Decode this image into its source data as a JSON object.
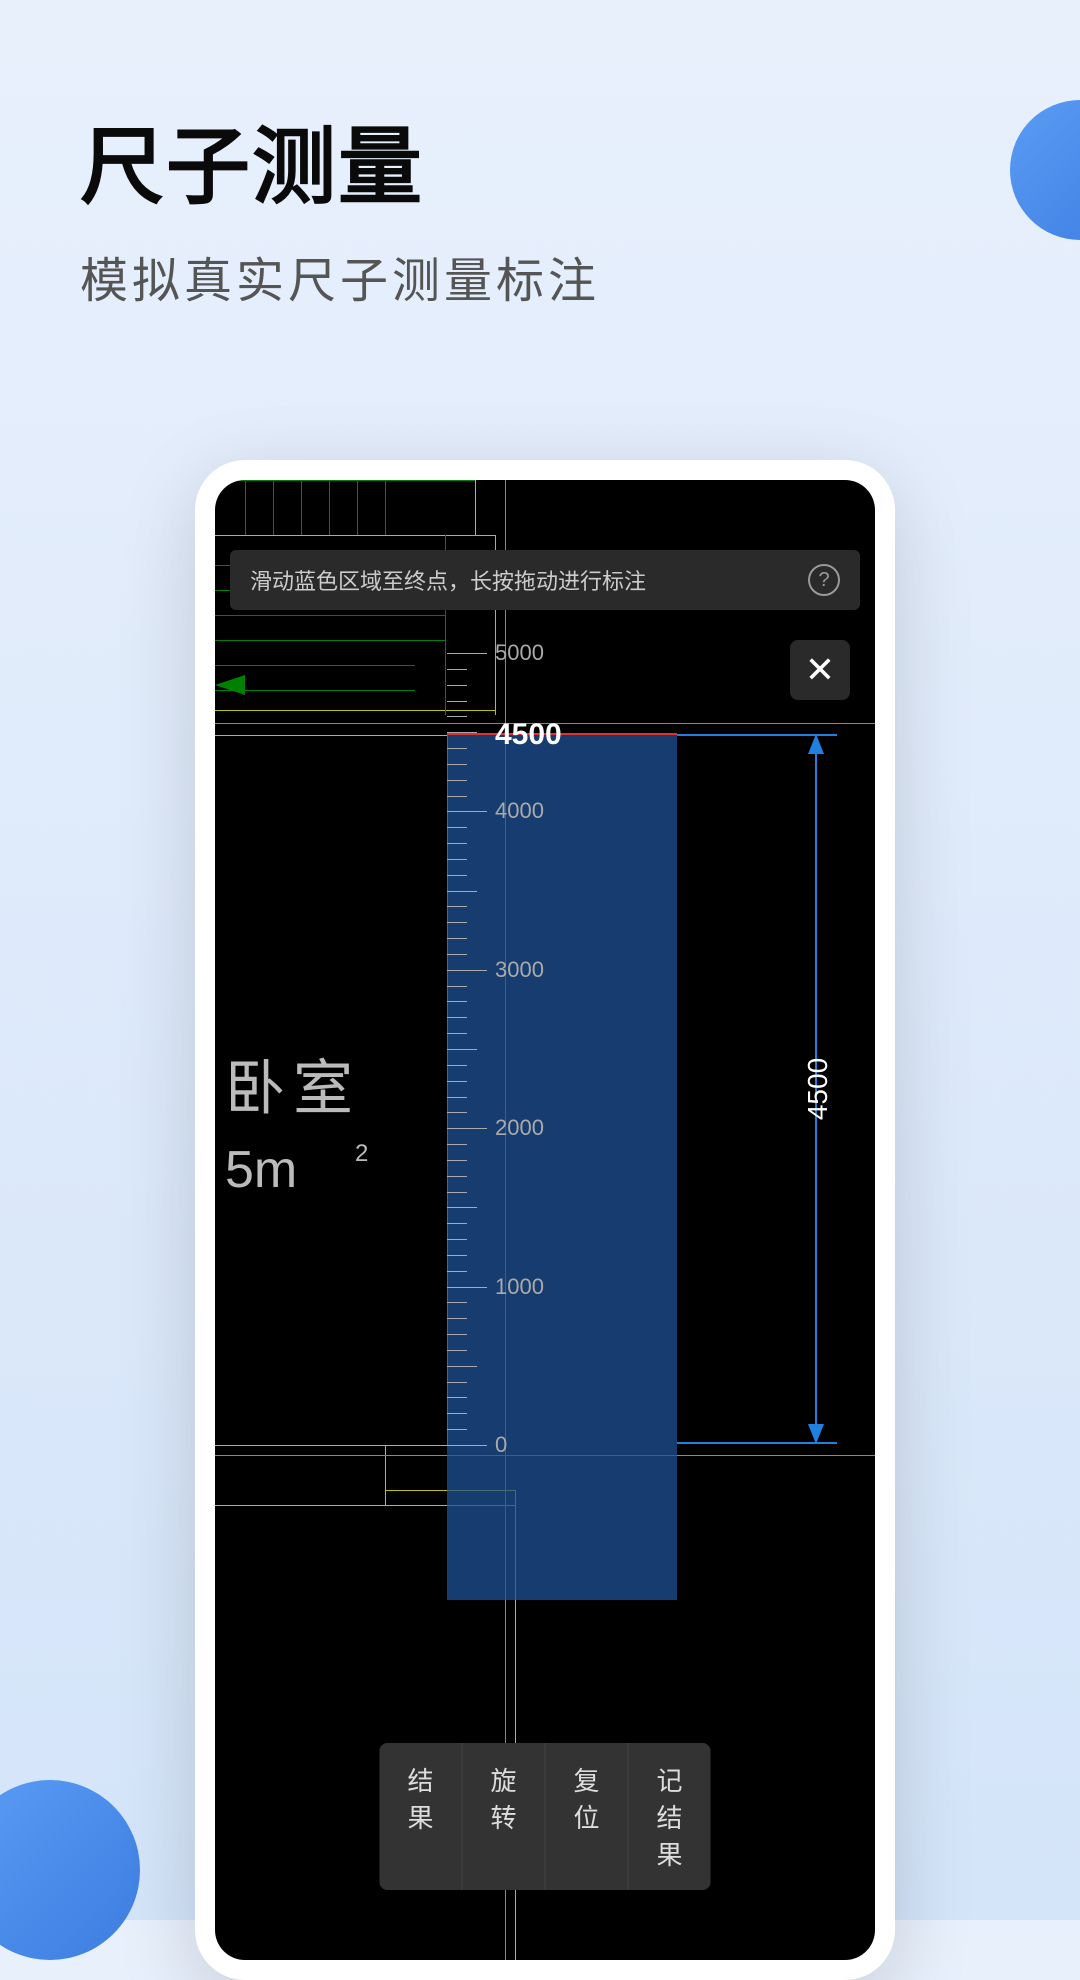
{
  "header": {
    "title": "尺子测量",
    "subtitle": "模拟真实尺子测量标注"
  },
  "hint": {
    "text": "滑动蓝色区域至终点，长按拖动进行标注",
    "help_symbol": "?"
  },
  "close": {
    "symbol": "✕"
  },
  "cad": {
    "room_label": "卧室",
    "room_size": "5m",
    "room_sup": "2"
  },
  "ruler": {
    "current_value": "4500",
    "labels": {
      "t5000": "5000",
      "t4000": "4000",
      "t3000": "3000",
      "t2000": "2000",
      "t1000": "1000",
      "t0": "0"
    }
  },
  "dimension": {
    "value": "4500"
  },
  "toolbar": {
    "result": "结果",
    "rotate": "旋转",
    "reset": "复位",
    "save_result": "记结果"
  }
}
